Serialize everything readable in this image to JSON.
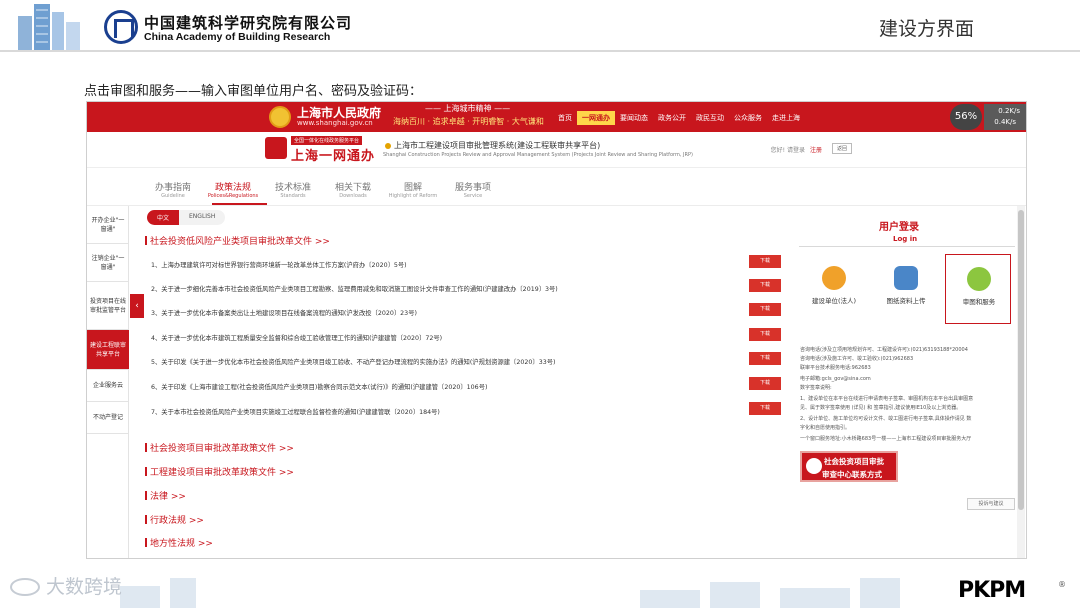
{
  "slide": {
    "org_name_cn": "中国建筑科学研究院有限公司",
    "org_name_en": "China Academy of Building Research",
    "title": "建设方界面",
    "instruction": "点击审图和服务——输入审图单位用户名、密码及验证码："
  },
  "gov_header": {
    "name": "上海市人民政府",
    "url": "www.shanghai.gov.cn",
    "slogan_top": "—— 上海城市精神 ——",
    "slogan": "海纳百川 · 追求卓越 · 开明睿智 · 大气谦和",
    "nav": [
      {
        "label": "首页",
        "active": false
      },
      {
        "label": "一网通办",
        "active": true
      },
      {
        "label": "要闻动态",
        "active": false
      },
      {
        "label": "政务公开",
        "active": false
      },
      {
        "label": "政民互动",
        "active": false
      },
      {
        "label": "公众服务",
        "active": false
      },
      {
        "label": "走进上海",
        "active": false
      }
    ],
    "weather_value": "56",
    "weather_unit": "%",
    "weather_a": "0.2K/s",
    "weather_b": "0.4K/s"
  },
  "portal": {
    "tag": "全国一体化在线政务服务平台",
    "name": "上海一网通办",
    "system_title": "上海市工程建设项目审批管理系统(建设工程联审共享平台)",
    "system_en": "Shanghai Construction Projects Review and Approval Management System (Projects Joint Review and Sharing Platform, JRP)",
    "welcome": "您好! 请登录",
    "register": "注册",
    "back": "返回"
  },
  "tabs": [
    {
      "label": "办事指南",
      "en": "Guideline",
      "active": false
    },
    {
      "label": "政策法规",
      "en": "Polices&Regulations",
      "active": true
    },
    {
      "label": "技术标准",
      "en": "Standards",
      "active": false
    },
    {
      "label": "相关下载",
      "en": "Downloads",
      "active": false
    },
    {
      "label": "图解",
      "en": "Highlight of Reform",
      "active": false
    },
    {
      "label": "服务事项",
      "en": "Service",
      "active": false
    }
  ],
  "left_nav": [
    {
      "label": "开办企业\"一窗通\"",
      "active": false
    },
    {
      "label": "注销企业\"一窗通\"",
      "active": false
    },
    {
      "label": "投资项目在线审批监管平台",
      "active": false
    },
    {
      "label": "建设工程联审共享平台",
      "active": true
    },
    {
      "label": "企业服务云",
      "active": false
    },
    {
      "label": "不动产登记",
      "active": false
    }
  ],
  "lang": {
    "zh": "中文",
    "en": "ENGLISH"
  },
  "sections": [
    "社会投资低风险产业类项目审批改革文件 >>",
    "社会投资项目审批改革政策文件 >>",
    "工程建设项目审批改革政策文件 >>",
    "法律 >>",
    "行政法规 >>",
    "地方性法规 >>"
  ],
  "documents": [
    "1、上海办理建筑许可对标世界银行营商环境新一轮改革总体工作方案(沪府办〔2020〕5号)",
    "2、关于进一步细化完善本市社会投资低风险产业类项目工程勘察、监理費用减免和取消施工图设计文件审查工作的通知(沪建建改办〔2019〕3号)",
    "3、关于进一步优化本市备案类出让土地建设项目在线备案流程的通知(沪发改投〔2020〕23号)",
    "4、关于进一步优化本市建筑工程质量安全监督和综合竣工验收管理工作的通知(沪建建管〔2020〕72号)",
    "5、关于印发《关于进一步优化本市社会投资低风险产业类项目竣工验收、不动产登记办理流程的实施办法》的通知(沪规划资源建〔2020〕33号)",
    "6、关于印发《上海市建设工程(社会投资低风险产业类项目)勘察合同示范文本(试行)》的通知(沪建建管〔2020〕106号)",
    "7、关于本市社会投资低风险产业类项目实施竣工过程联合监督检查的通知(沪建建管联〔2020〕184号)"
  ],
  "download_label": "下载",
  "login_panel": {
    "title": "用户登录",
    "title_en": "Log in",
    "cards": [
      {
        "label": "建设单位(法人)",
        "icon": "person-icon",
        "color": "#f0a12a"
      },
      {
        "label": "图纸资料上传",
        "icon": "document-upload-icon",
        "color": "#4a86c8"
      },
      {
        "label": "审图和服务",
        "icon": "review-service-icon",
        "color": "#8cc63f"
      }
    ]
  },
  "info": [
    "咨询电话(涉及立项用地规划许可、工程建设许可):(021)63193188*20004",
    "咨询电话(涉及施工许可、竣工验收):(021)962683",
    "联审平台技术服务电话:962683",
    "电子邮箱:gcls_gov@sina.com",
    "数字签章说明:",
    "1、建设单位在本平台在线进行申请表电子签章、审图机构在本平台出具审图意",
    "见、属于数字签章使用 (详见) 和 签章指引,建议使用IE10及以上浏览器。",
    "2、设计单位、施工单位均可设计文件、竣工图进行电子签章,具体操作请见 数",
    "字化和自愿使用指引。",
    "一个窗口服务地址:小木桥路683号一楼——上海市工程建设项目审批服务大厅"
  ],
  "banner": {
    "line1": "社会投资项目审批",
    "line2": "审查中心联系方式"
  },
  "feedback": "投诉与建议",
  "footer": {
    "brand_left": "大数跨境",
    "brand_right": "PKPM",
    "registered": "®"
  },
  "colors": {
    "gov_red": "#c8161d",
    "accent_yellow": "#ffd64a",
    "cabr_blue": "#1a3f8f"
  }
}
